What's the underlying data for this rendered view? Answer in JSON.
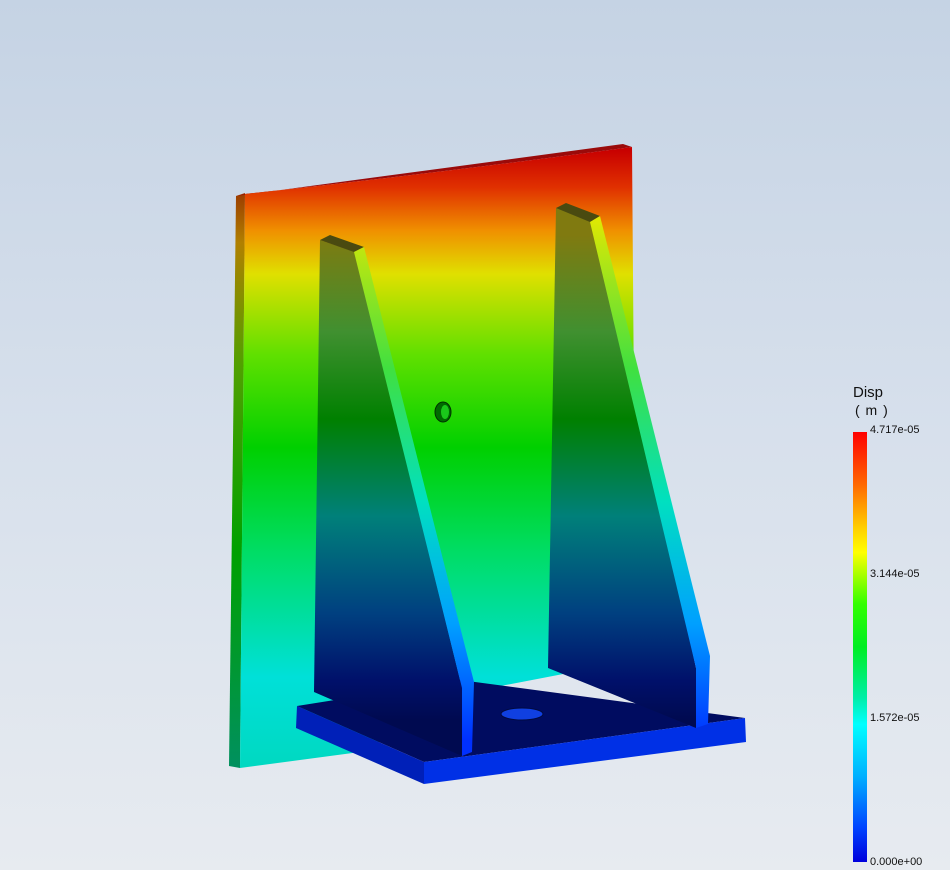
{
  "legend": {
    "title": "Disp",
    "unit": "( m )",
    "ticks": [
      "4.717e-05",
      "3.144e-05",
      "1.572e-05",
      "0.000e+00"
    ]
  },
  "colors": {
    "max": "#ff0000",
    "min": "#0000dd",
    "background_top": "#c5d3e4",
    "background_bottom": "#e7ebf0"
  }
}
